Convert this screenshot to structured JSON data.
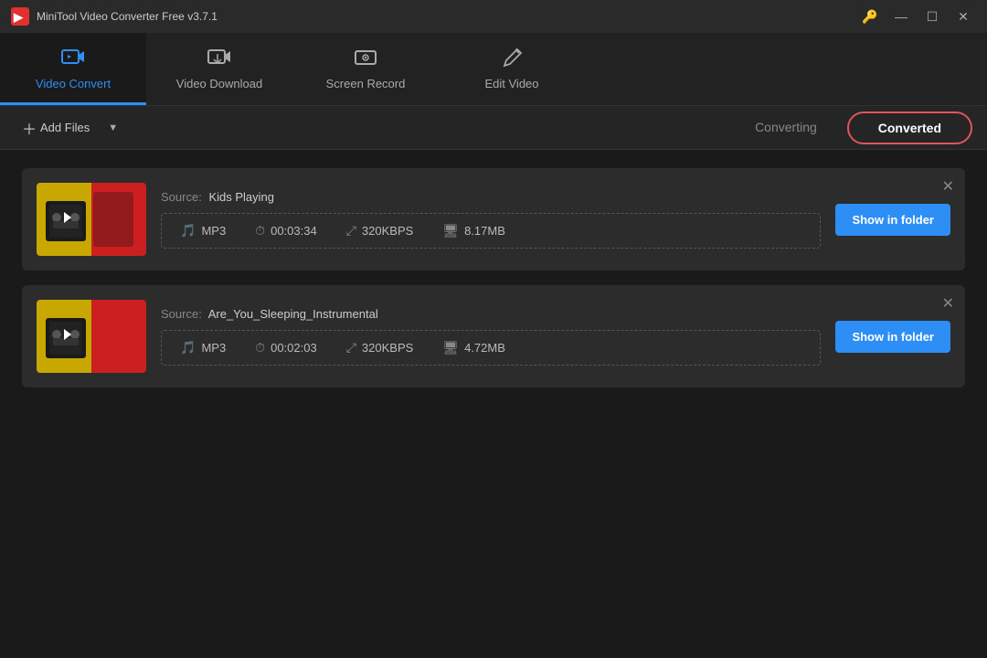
{
  "titleBar": {
    "appTitle": "MiniTool Video Converter Free v3.7.1",
    "keyIcon": "🔑",
    "minimizeIcon": "—",
    "maximizeIcon": "☐",
    "closeIcon": "✕"
  },
  "nav": {
    "items": [
      {
        "id": "video-convert",
        "label": "Video Convert",
        "active": true
      },
      {
        "id": "video-download",
        "label": "Video Download",
        "active": false
      },
      {
        "id": "screen-record",
        "label": "Screen Record",
        "active": false
      },
      {
        "id": "edit-video",
        "label": "Edit Video",
        "active": false
      }
    ]
  },
  "toolbar": {
    "addFilesLabel": "Add Files",
    "tabs": [
      {
        "id": "converting",
        "label": "Converting",
        "active": false
      },
      {
        "id": "converted",
        "label": "Converted",
        "active": true
      }
    ]
  },
  "files": [
    {
      "id": "file-1",
      "sourceLabel": "Source:",
      "sourceName": "Kids Playing",
      "format": "MP3",
      "duration": "00:03:34",
      "bitrate": "320KBPS",
      "size": "8.17MB",
      "showFolderLabel": "Show in folder"
    },
    {
      "id": "file-2",
      "sourceLabel": "Source:",
      "sourceName": "Are_You_Sleeping_Instrumental",
      "format": "MP3",
      "duration": "00:02:03",
      "bitrate": "320KBPS",
      "size": "4.72MB",
      "showFolderLabel": "Show in folder"
    }
  ]
}
